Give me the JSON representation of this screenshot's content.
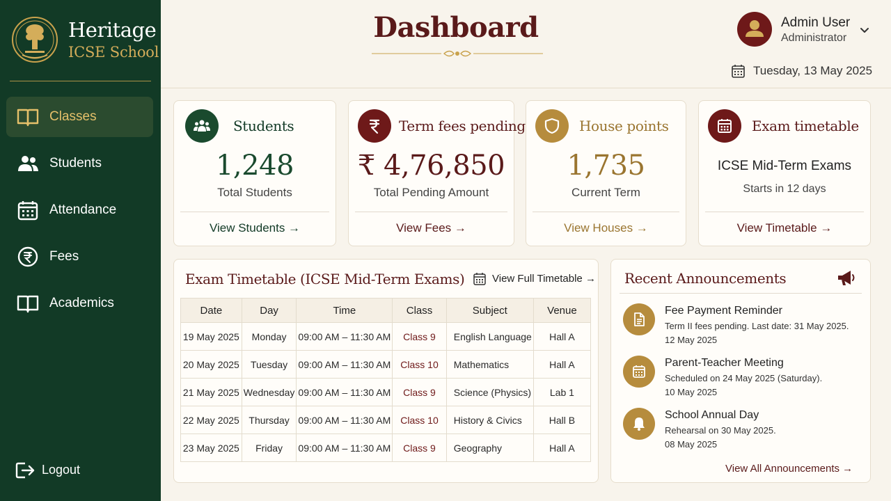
{
  "brand": {
    "line1": "Heritage",
    "line2": "ICSE School"
  },
  "nav": {
    "items": [
      {
        "label": "Classes",
        "icon": "book-open-icon",
        "active": true
      },
      {
        "label": "Students",
        "icon": "users-icon"
      },
      {
        "label": "Attendance",
        "icon": "calendar-icon"
      },
      {
        "label": "Fees",
        "icon": "rupee-icon"
      },
      {
        "label": "Academics",
        "icon": "book-icon"
      }
    ],
    "logout": "Logout"
  },
  "header": {
    "title": "Dashboard",
    "user": {
      "name": "Admin User",
      "role": "Administrator"
    },
    "date": "Tuesday, 13 May 2025"
  },
  "cards": {
    "students": {
      "title": "Students",
      "value": "1,248",
      "sub": "Total Students",
      "link": "View Students →"
    },
    "fees": {
      "title": "Term fees pending",
      "value": "₹ 4,76,850",
      "sub": "Total Pending Amount",
      "link": "View Fees →"
    },
    "houses": {
      "title": "House points",
      "value": "1,735",
      "sub": "Current Term",
      "link": "View Houses →"
    },
    "exams": {
      "title": "Exam timetable",
      "event": "ICSE Mid-Term Exams",
      "sub": "Starts in 12 days",
      "link": "View Timetable →"
    }
  },
  "timetable": {
    "title": "Exam Timetable (ICSE Mid-Term Exams)",
    "link": "View Full Timetable →",
    "headers": [
      "Date",
      "Day",
      "Time",
      "Class",
      "Subject",
      "Venue"
    ],
    "rows": [
      [
        "19 May 2025",
        "Monday",
        "09:00 AM – 11:30 AM",
        "Class 9",
        "English Language",
        "Hall A"
      ],
      [
        "20 May 2025",
        "Tuesday",
        "09:00 AM – 11:30 AM",
        "Class 10",
        "Mathematics",
        "Hall A"
      ],
      [
        "21 May 2025",
        "Wednesday",
        "09:00 AM – 11:30 AM",
        "Class 9",
        "Science (Physics)",
        "Lab 1"
      ],
      [
        "22 May 2025",
        "Thursday",
        "09:00 AM – 11:30 AM",
        "Class 10",
        "History & Civics",
        "Hall B"
      ],
      [
        "23 May 2025",
        "Friday",
        "09:00 AM – 11:30 AM",
        "Class 9",
        "Geography",
        "Hall A"
      ]
    ]
  },
  "announcements": {
    "title": "Recent Announcements",
    "items": [
      {
        "title": "Fee Payment Reminder",
        "desc": "Term II fees pending. Last date: 31 May 2025.",
        "date": "12 May 2025",
        "icon": "document-icon"
      },
      {
        "title": "Parent-Teacher Meeting",
        "desc": "Scheduled on 24 May 2025 (Saturday).",
        "date": "10 May 2025",
        "icon": "calendar-icon"
      },
      {
        "title": "School Annual Day",
        "desc": "Rehearsal on 30 May 2025.",
        "date": "08 May 2025",
        "icon": "bell-icon"
      }
    ],
    "view_all": "View All Announcements →"
  },
  "colors": {
    "sidebar": "#123a26",
    "maroon": "#6e1919",
    "gold": "#b68c3d",
    "green": "#1a4a2e",
    "background": "#f8f4ec"
  }
}
